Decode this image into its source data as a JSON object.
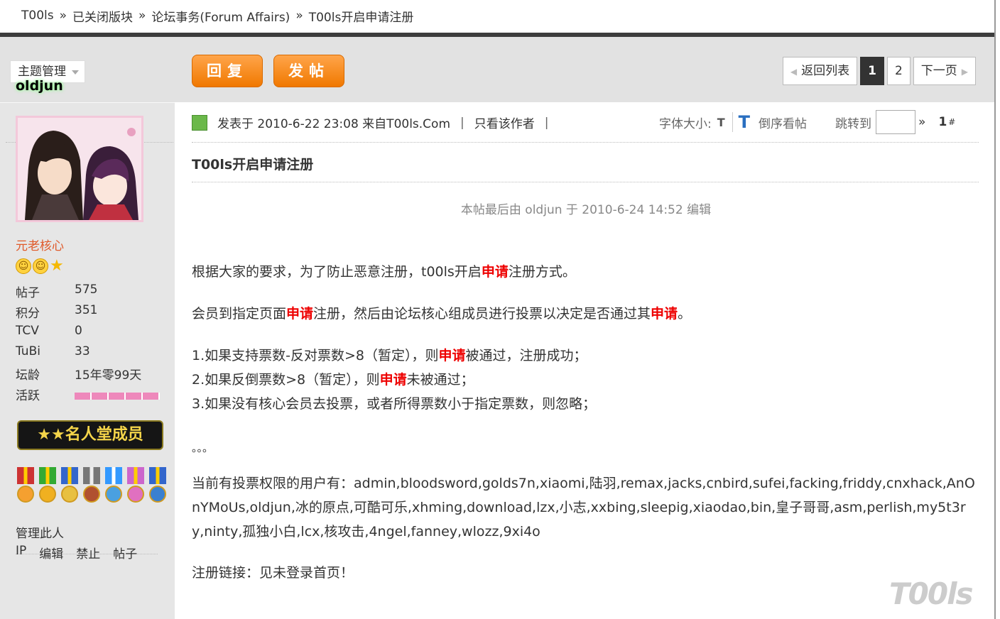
{
  "breadcrumb": {
    "items": [
      "T00ls",
      "已关闭版块",
      "论坛事务(Forum Affairs)",
      "T00ls开启申请注册"
    ],
    "separator": "»"
  },
  "sidebar": {
    "topic_manage": "主题管理",
    "username": "oldjun",
    "rank": "元老核心",
    "stats": [
      {
        "key": "帖子",
        "value": "575"
      },
      {
        "key": "积分",
        "value": "351"
      },
      {
        "key": "TCV",
        "value": "0"
      },
      {
        "key": "TuBi",
        "value": "33"
      },
      {
        "key": "坛龄",
        "value": "15年零99天"
      },
      {
        "key": "活跃",
        "value": ""
      }
    ],
    "hall_badge": "★★名人堂成员",
    "manage_title": "管理此人",
    "manage_links": [
      "IP",
      "编辑",
      "禁止",
      "帖子"
    ]
  },
  "toolbar": {
    "reply_label": "回复",
    "post_label": "发帖",
    "pager": {
      "back": "返回列表",
      "pages": [
        "1",
        "2"
      ],
      "next": "下一页"
    }
  },
  "post": {
    "meta": "发表于 2010-6-22 23:08 来自T00ls.Com",
    "meta_sep": "|",
    "author_only": "只看该作者",
    "font_size_label": "字体大小:",
    "font_small": "T",
    "font_large": "T",
    "reverse": "倒序看帖",
    "jump_label": "跳转到",
    "jump_arrow": "»",
    "floor": "1",
    "floor_mark": "#",
    "title": "T00ls开启申请注册",
    "edited": "本帖最后由 oldjun 于 2010-6-24 14:52 编辑",
    "p1a": "根据大家的要求，为了防止恶意注册，t00ls开启",
    "hl": "申请",
    "p1b": "注册方式。",
    "p2a": "会员到指定页面",
    "p2b": "注册，然后由论坛核心组成员进行投票以决定是否通过其",
    "p2c": "。",
    "l1a": "1.如果支持票数-反对票数>8（暂定），则",
    "l1b": "被通过，注册成功；",
    "l2a": "2.如果反倒票数>8（暂定），则",
    "l2b": "未被通过；",
    "l3": "3.如果没有核心会员去投票，或者所得票数小于指定票数，则忽略；",
    "dots": "。。。",
    "voters": "当前有投票权限的用户有：admin,bloodsword,golds7n,xiaomi,陆羽,remax,jacks,cnbird,sufei,facking,friddy,cnxhack,AnOnYMoUs,oldjun,冰的原点,可酷可乐,xhming,download,lzx,小志,xxbing,sleepig,xiaodao,bin,皇子哥哥,asm,perlish,my5t3ry,ninty,孤独小白,lcx,核攻击,4ngel,fanney,wlozz,9xi4o",
    "register": "注册链接：见未登录首页！"
  },
  "watermark": "T00ls",
  "colors": {
    "accent_orange": "#f07800",
    "highlight_red": "#e00000",
    "rank_orange": "#e05a2a"
  }
}
